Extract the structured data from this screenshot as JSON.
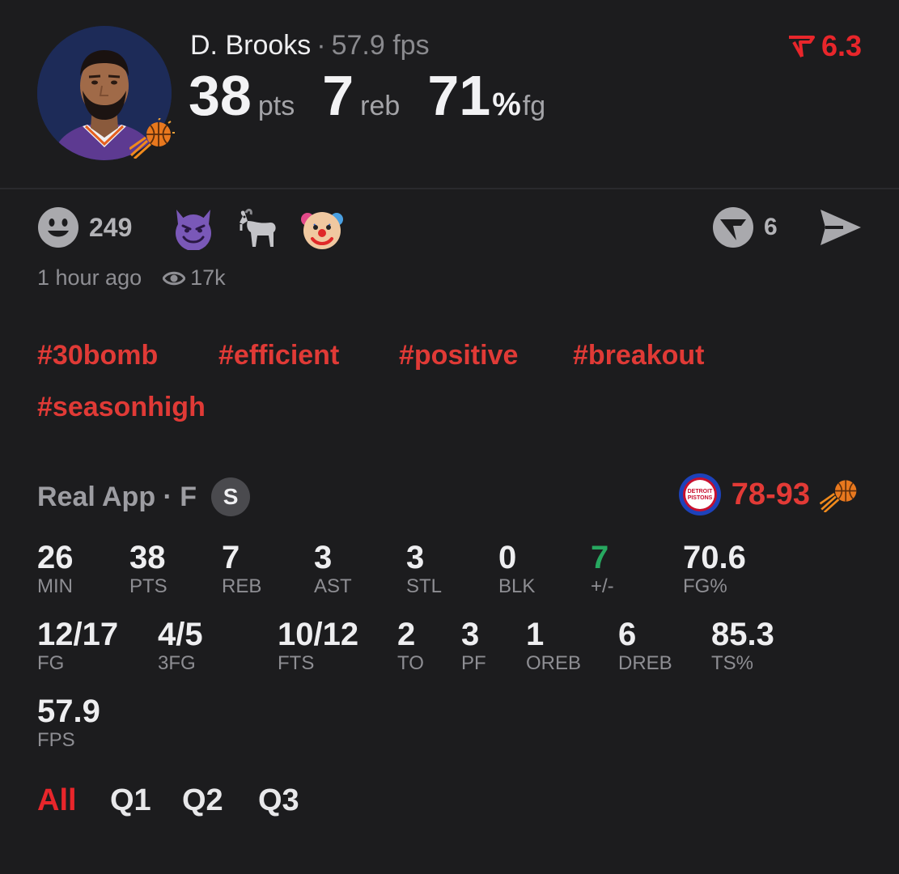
{
  "player": {
    "name": "D. Brooks",
    "fps_summary": "57.9 fps",
    "pts": "38",
    "pts_unit": "pts",
    "reb": "7",
    "reb_unit": "reb",
    "fg_pct": "71",
    "pct_sign": "%",
    "fg_unit": "fg"
  },
  "rating": {
    "value": "6.3",
    "color": "#e8262b",
    "icon": "real-rating-icon"
  },
  "reactions": {
    "smile_count": "249",
    "emojis": [
      "smiling-devil-icon",
      "goat-icon",
      "clown-face-icon"
    ],
    "app_count": "6"
  },
  "meta": {
    "time_ago": "1 hour ago",
    "views": "17k"
  },
  "hashtags": [
    "#30bomb",
    "#efficient",
    "#positive",
    "#breakout",
    "#seasonhigh"
  ],
  "game": {
    "source": "Real App · F",
    "badge": "S",
    "score": "78-93",
    "opponent_logo_text": "DETROIT PISTONS"
  },
  "stats": [
    {
      "value": "26",
      "label": "MIN"
    },
    {
      "value": "38",
      "label": "PTS"
    },
    {
      "value": "7",
      "label": "REB"
    },
    {
      "value": "3",
      "label": "AST"
    },
    {
      "value": "3",
      "label": "STL"
    },
    {
      "value": "0",
      "label": "BLK"
    },
    {
      "value": "7",
      "label": "+/-",
      "positive": true
    },
    {
      "value": "70.6",
      "label": "FG%"
    },
    {
      "value": "12/17",
      "label": "FG"
    },
    {
      "value": "4/5",
      "label": "3FG"
    },
    {
      "value": "10/12",
      "label": "FTS"
    },
    {
      "value": "2",
      "label": "TO"
    },
    {
      "value": "3",
      "label": "PF"
    },
    {
      "value": "1",
      "label": "OREB"
    },
    {
      "value": "6",
      "label": "DREB"
    },
    {
      "value": "85.3",
      "label": "TS%"
    },
    {
      "value": "57.9",
      "label": "FPS"
    }
  ],
  "periods": [
    "All",
    "Q1",
    "Q2",
    "Q3"
  ],
  "active_period": "All",
  "colors": {
    "accent_red": "#e8262b",
    "positive_green": "#27a860",
    "background": "#1c1c1e"
  }
}
